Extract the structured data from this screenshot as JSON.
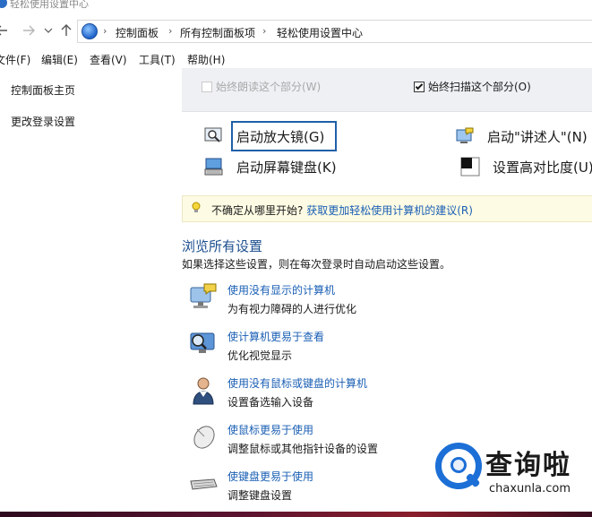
{
  "window": {
    "title": "轻松使用设置中心"
  },
  "nav": {
    "breadcrumb": [
      "控制面板",
      "所有控制面板项",
      "轻松使用设置中心"
    ]
  },
  "menu": [
    "文件(F)",
    "编辑(E)",
    "查看(V)",
    "工具(T)",
    "帮助(H)"
  ],
  "sidebar": {
    "items": [
      {
        "label": "控制面板主页"
      },
      {
        "label": "更改登录设置"
      }
    ]
  },
  "options": {
    "always_read": {
      "label": "始终朗读这个部分(W)",
      "checked": false,
      "enabled": false
    },
    "always_scan": {
      "label": "始终扫描这个部分(O)",
      "checked": true,
      "enabled": true
    }
  },
  "quick_access": {
    "magnifier": "启动放大镜(G)",
    "narrator": "启动\"讲述人\"(N)",
    "keyboard": "启动屏幕键盘(K)",
    "contrast": "设置高对比度(U)"
  },
  "tip": {
    "prefix": "不确定从哪里开始?",
    "link": "获取更加轻松使用计算机的建议(R)"
  },
  "browse": {
    "title": "浏览所有设置",
    "description": "如果选择这些设置，则在每次登录时自动启动这些设置。",
    "items": [
      {
        "link": "使用没有显示的计算机",
        "desc": "为有视力障碍的人进行优化",
        "icon": "monitor-speech-icon"
      },
      {
        "link": "使计算机更易于查看",
        "desc": "优化视觉显示",
        "icon": "monitor-magnifier-icon"
      },
      {
        "link": "使用没有鼠标或键盘的计算机",
        "desc": "设置备选输入设备",
        "icon": "person-icon"
      },
      {
        "link": "使鼠标更易于使用",
        "desc": "调整鼠标或其他指针设备的设置",
        "icon": "mouse-icon"
      },
      {
        "link": "使键盘更易于使用",
        "desc": "调整键盘设置",
        "icon": "keyboard-icon"
      }
    ]
  },
  "watermark": {
    "brand": "查询啦",
    "domain": "chaxunla.com"
  },
  "colors": {
    "link": "#1a5fb4",
    "heading": "#1c4f8f",
    "tip_bg": "#fdfbe3",
    "focus": "#1f5fa8"
  }
}
